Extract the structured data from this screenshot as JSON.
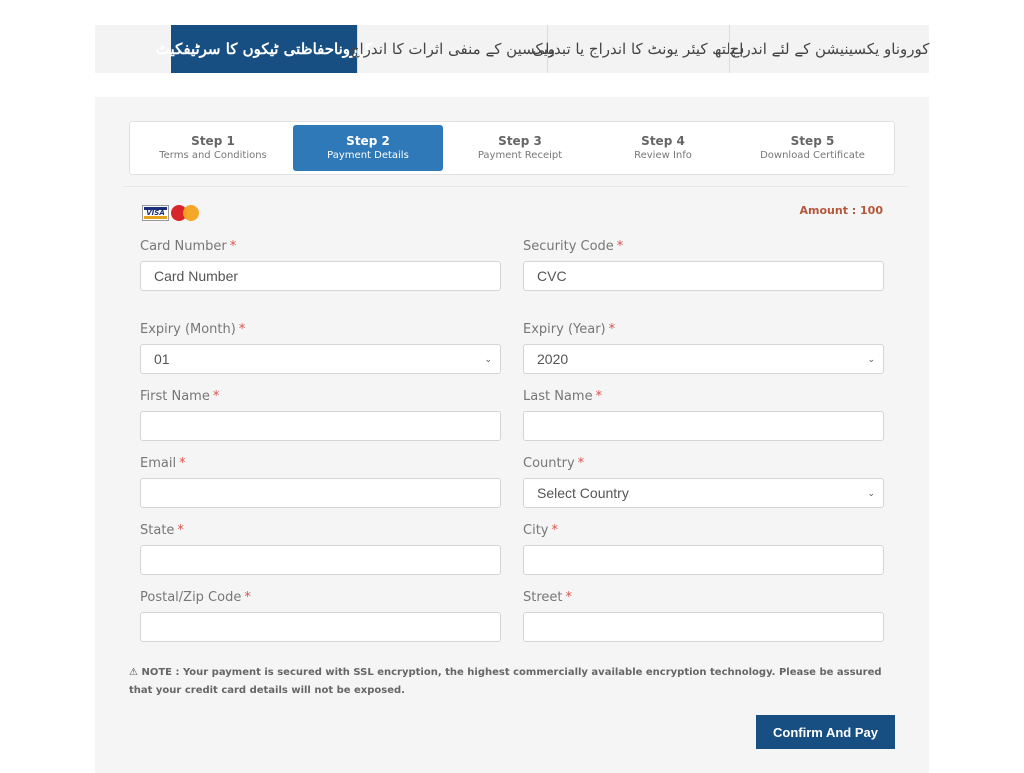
{
  "topnav": {
    "tabs": [
      {
        "label": "کوروناو یکسینیشن کے لئے اندراج",
        "active": false
      },
      {
        "label": "ہیلتھ کیئر یونٹ کا اندراج یا تبدیلی",
        "active": false
      },
      {
        "label": "ویکسین کے منفی اثرات کا اندراج",
        "active": false
      },
      {
        "label": "کوروناحفاظتی ٹیکوں کا سرٹیفکیٹ",
        "active": true
      }
    ]
  },
  "steps": [
    {
      "num": "Step 1",
      "label": "Terms and Conditions",
      "active": false
    },
    {
      "num": "Step 2",
      "label": "Payment Details",
      "active": true
    },
    {
      "num": "Step 3",
      "label": "Payment Receipt",
      "active": false
    },
    {
      "num": "Step 4",
      "label": "Review Info",
      "active": false
    },
    {
      "num": "Step 5",
      "label": "Download Certificate",
      "active": false
    }
  ],
  "cards": {
    "visa": "VISA",
    "mastercard": "MasterCard"
  },
  "amount": "Amount : 100",
  "colors": {
    "primary": "#174f82",
    "step_active": "#2f79b9",
    "amount": "#b4583c",
    "required": "#d9534f"
  },
  "form": {
    "required_mark": "*",
    "card_number": {
      "label": "Card Number",
      "placeholder": "Card Number",
      "value": ""
    },
    "security_code": {
      "label": "Security Code",
      "placeholder": "CVC",
      "value": ""
    },
    "expiry_month": {
      "label": "Expiry (Month)",
      "selected": "01"
    },
    "expiry_year": {
      "label": "Expiry (Year)",
      "selected": "2020"
    },
    "first_name": {
      "label": "First Name",
      "value": ""
    },
    "last_name": {
      "label": "Last Name",
      "value": ""
    },
    "email": {
      "label": "Email",
      "value": ""
    },
    "country": {
      "label": "Country",
      "selected": "Select Country"
    },
    "state": {
      "label": "State",
      "value": ""
    },
    "city": {
      "label": "City",
      "value": ""
    },
    "postal_code": {
      "label": "Postal/Zip Code",
      "value": ""
    },
    "street": {
      "label": "Street",
      "value": ""
    }
  },
  "note": {
    "icon": "warning-icon",
    "text": "NOTE : Your payment is secured with SSL encryption, the highest commercially available encryption technology. Please be assured that your credit card details will not be exposed."
  },
  "confirm_button": "Confirm And Pay"
}
